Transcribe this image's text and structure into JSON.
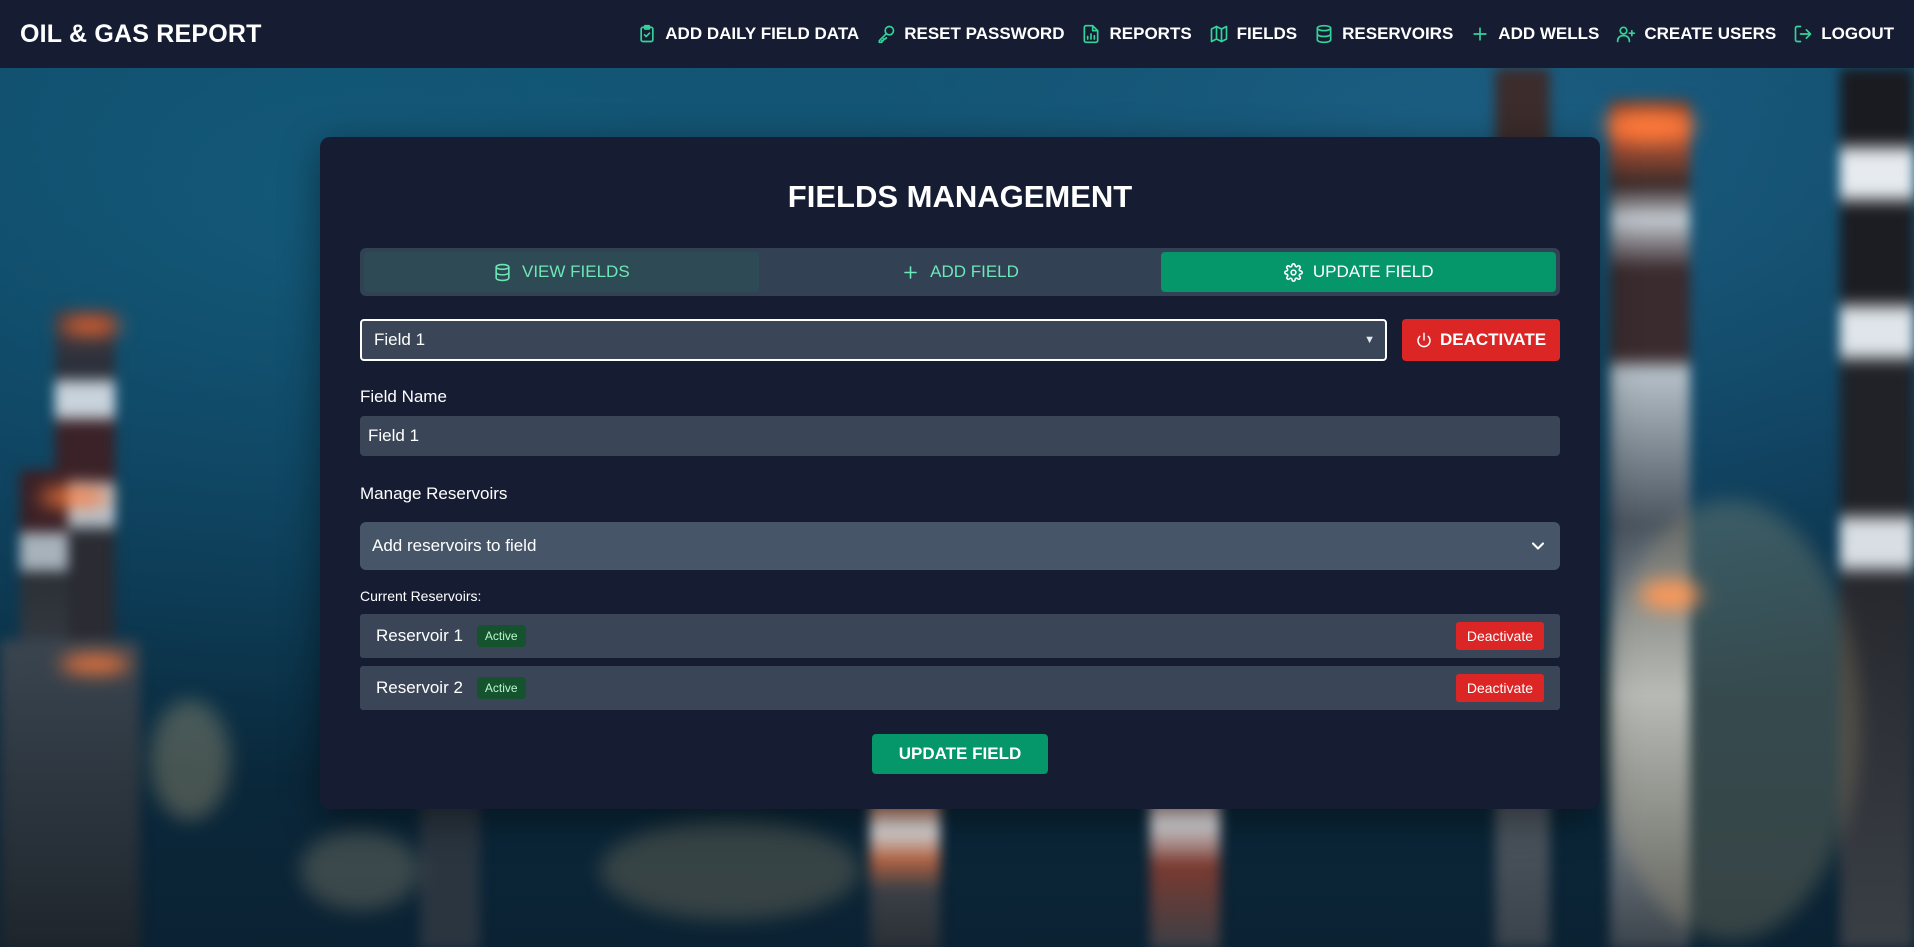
{
  "app": {
    "title": "OIL & GAS REPORT"
  },
  "nav": [
    {
      "label": "ADD DAILY FIELD DATA",
      "icon": "clipboard-check-icon"
    },
    {
      "label": "RESET PASSWORD",
      "icon": "key-icon"
    },
    {
      "label": "REPORTS",
      "icon": "bar-chart-file-icon"
    },
    {
      "label": "FIELDS",
      "icon": "map-icon"
    },
    {
      "label": "RESERVOIRS",
      "icon": "database-icon"
    },
    {
      "label": "ADD WELLS",
      "icon": "plus-icon"
    },
    {
      "label": "CREATE USERS",
      "icon": "user-plus-icon"
    },
    {
      "label": "LOGOUT",
      "icon": "logout-icon"
    }
  ],
  "page": {
    "title": "FIELDS MANAGEMENT",
    "tabs": [
      {
        "label": "VIEW FIELDS",
        "icon": "database-icon"
      },
      {
        "label": "ADD FIELD",
        "icon": "plus-icon"
      },
      {
        "label": "UPDATE FIELD",
        "icon": "gear-icon",
        "active": true
      }
    ],
    "field_select": {
      "value": "Field 1"
    },
    "deactivate_label": "DEACTIVATE",
    "field_name": {
      "label": "Field Name",
      "value": "Field 1"
    },
    "manage_reservoirs": {
      "label": "Manage Reservoirs",
      "placeholder": "Add reservoirs to field"
    },
    "current_reservoirs_label": "Current Reservoirs:",
    "reservoirs": [
      {
        "name": "Reservoir 1",
        "status": "Active",
        "action": "Deactivate"
      },
      {
        "name": "Reservoir 2",
        "status": "Active",
        "action": "Deactivate"
      }
    ],
    "submit_label": "UPDATE FIELD"
  },
  "colors": {
    "accent": "#059669",
    "accent_light": "#34d399",
    "danger": "#dc2626",
    "panel": "#161d33",
    "input": "#3a4658",
    "badge_bg": "#14532d"
  }
}
